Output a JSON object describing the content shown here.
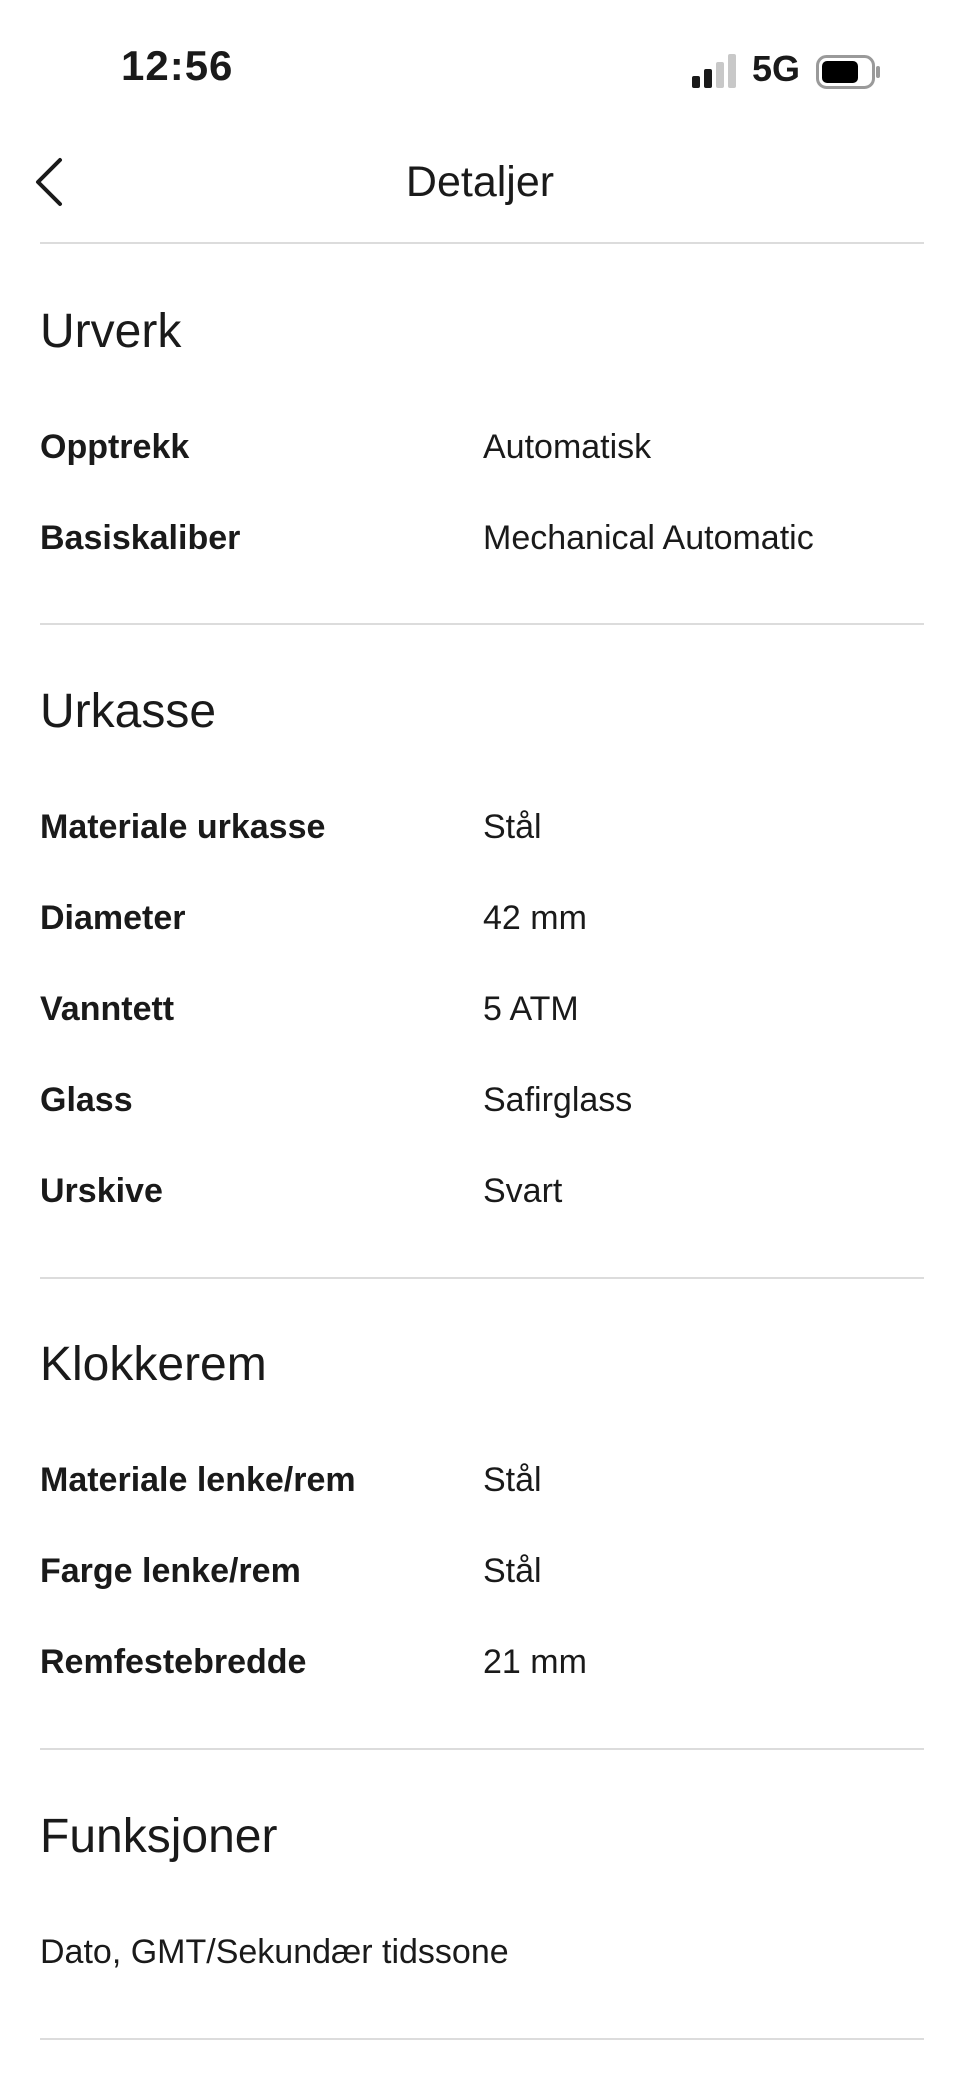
{
  "status_bar": {
    "time": "12:56",
    "network": "5G",
    "signal_bars_active": 2,
    "signal_bars_total": 4,
    "battery_level": 0.7
  },
  "nav": {
    "back_icon": "chevron-left-icon",
    "title": "Detaljer"
  },
  "sections": {
    "urverk": {
      "title": "Urverk",
      "rows": [
        {
          "label": "Opptrekk",
          "value": "Automatisk"
        },
        {
          "label": "Basiskaliber",
          "value": "Mechanical Automatic"
        }
      ]
    },
    "urkasse": {
      "title": "Urkasse",
      "rows": [
        {
          "label": "Materiale urkasse",
          "value": "Stål"
        },
        {
          "label": "Diameter",
          "value": "42 mm"
        },
        {
          "label": "Vanntett",
          "value": "5 ATM"
        },
        {
          "label": "Glass",
          "value": "Safirglass"
        },
        {
          "label": "Urskive",
          "value": "Svart"
        }
      ]
    },
    "klokkerem": {
      "title": "Klokkerem",
      "rows": [
        {
          "label": "Materiale lenke/rem",
          "value": "Stål"
        },
        {
          "label": "Farge lenke/rem",
          "value": "Stål"
        },
        {
          "label": "Remfestebredde",
          "value": "21 mm"
        }
      ]
    },
    "funksjoner": {
      "title": "Funksjoner",
      "text": "Dato, GMT/Sekundær tidssone"
    }
  }
}
